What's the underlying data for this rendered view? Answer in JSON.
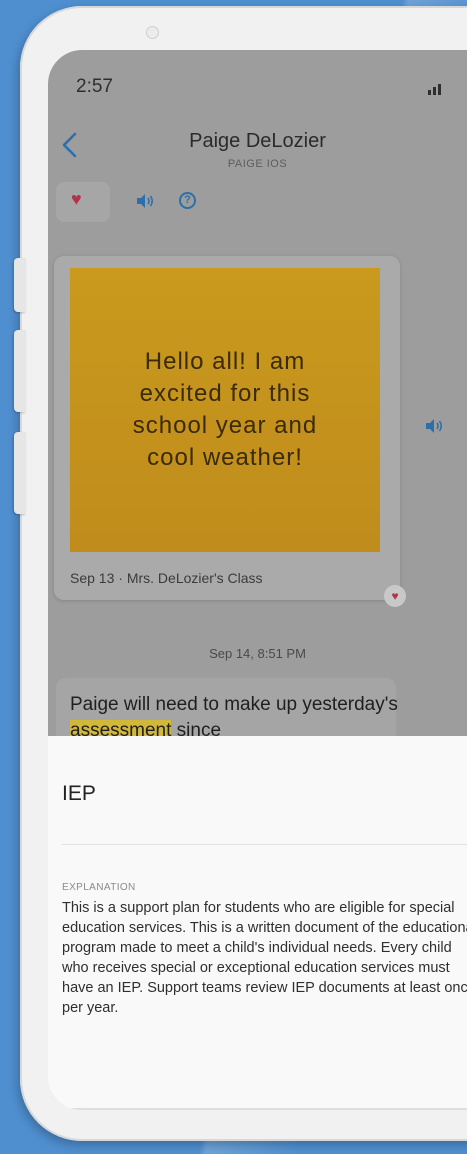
{
  "status_bar": {
    "time": "2:57"
  },
  "header": {
    "name": "Paige DeLozier",
    "subtitle": "PAIGE IOS"
  },
  "post": {
    "message": "Hello all! I am excited for this school year and cool weather!",
    "caption": "Sep 13 · Mrs. DeLozier's Class"
  },
  "thread": {
    "timestamp": "Sep 14, 8:51 PM",
    "message_before": "Paige will need to make up yesterday's ",
    "highlighted_word": "assessment",
    "message_after": " since"
  },
  "sheet": {
    "title": "IEP",
    "label": "EXPLANATION",
    "body": "This is a support plan for students who are eligible for special education services. This is a written document of the educational program made to meet a child's individual needs. Every child who receives special or exceptional education services must have an IEP. Support teams review IEP documents at least once per year."
  },
  "icons": {
    "back": "chevron-left-icon",
    "heart": "heart-icon",
    "speaker": "speaker-icon",
    "help": "help-circle-icon",
    "signal": "signal-bars-icon"
  },
  "colors": {
    "background": "#4f8fd0",
    "accent_blue": "#2c6fa9",
    "heart": "#b2334a",
    "highlight": "#d1b73a",
    "card_yellow": "#c99a1d"
  }
}
